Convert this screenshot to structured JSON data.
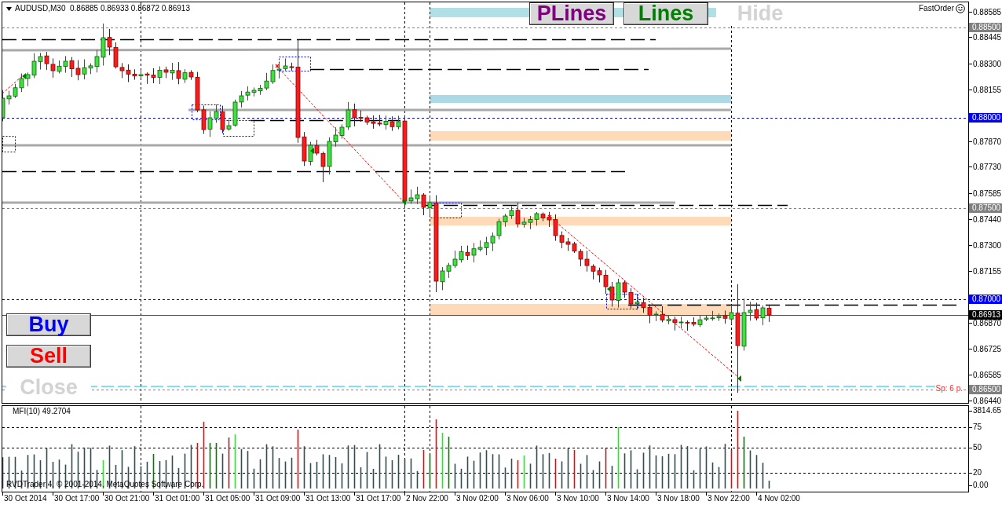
{
  "chart": {
    "title": "AUDUSD,M30  0.86885 0.86933 0.86872 0.86913",
    "fast_order": "FastOrder"
  },
  "top_buttons": [
    {
      "label": "PLines",
      "kind": "boxed",
      "color": "#800080"
    },
    {
      "label": "Lines",
      "kind": "boxed",
      "color": "#008000"
    },
    {
      "label": "Hide",
      "kind": "plain",
      "color": "#d3d3d3"
    }
  ],
  "trade_buttons": [
    {
      "label": "Buy",
      "kind": "boxed",
      "color": "#0000ff"
    },
    {
      "label": "Sell",
      "kind": "boxed",
      "color": "#ff0000"
    },
    {
      "label": "Close",
      "kind": "plain",
      "color": "#d3d3d3"
    }
  ],
  "spread": "Sp: 6 p.",
  "price_axis": {
    "ticks": [
      "0.88585",
      "0.88445",
      "0.88300",
      "0.88155",
      "0.87870",
      "0.87730",
      "0.87585",
      "0.87440",
      "0.87300",
      "0.87155",
      "0.86870",
      "0.86725",
      "0.86585",
      "0.86440"
    ],
    "markers": [
      {
        "label": "0.88500",
        "kind": "level"
      },
      {
        "label": "0.88000",
        "kind": "alert"
      },
      {
        "label": "0.87500",
        "kind": "level"
      },
      {
        "label": "0.87000",
        "kind": "alert"
      },
      {
        "label": "0.86913",
        "kind": "bid"
      },
      {
        "label": "0.86500",
        "kind": "level"
      }
    ]
  },
  "indicator": {
    "title": "MFI(10) 49.2704",
    "scale": [
      {
        "label": "3814.65",
        "kind": "max"
      },
      {
        "label": "75",
        "kind": "level"
      },
      {
        "label": "50",
        "kind": "level"
      },
      {
        "label": "20",
        "kind": "level"
      },
      {
        "label": "0.00",
        "kind": "min"
      }
    ]
  },
  "copyright": "RVDTrader 4, © 2001-2014, MetaQuotes Software Corp.",
  "time_axis": [
    "30 Oct 2014",
    "30 Oct 17:00",
    "30 Oct 21:00",
    "31 Oct 01:00",
    "31 Oct 05:00",
    "31 Oct 09:00",
    "31 Oct 13:00",
    "31 Oct 17:00",
    "2 Nov 22:00",
    "3 Nov 02:00",
    "3 Nov 06:00",
    "3 Nov 10:00",
    "3 Nov 14:00",
    "3 Nov 18:00",
    "3 Nov 22:00",
    "4 Nov 02:00"
  ]
}
